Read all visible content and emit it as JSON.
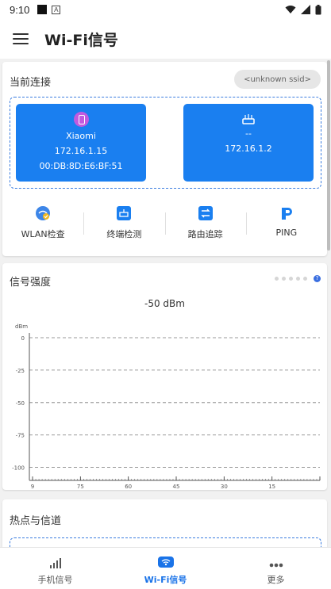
{
  "status_bar": {
    "time": "9:10",
    "app_badge": "A"
  },
  "app_bar": {
    "title": "Wi-Fi信号"
  },
  "connection": {
    "title": "当前连接",
    "ssid": "<unknown ssid>",
    "local_device": {
      "name": "Xiaomi",
      "ip": "172.16.1.15",
      "mac": "00:DB:8D:E6:BF:51"
    },
    "router": {
      "name": "--",
      "ip": "172.16.1.2"
    },
    "tools": [
      {
        "label": "WLAN检查",
        "icon": "wlan-check-icon"
      },
      {
        "label": "终端检测",
        "icon": "terminal-scan-icon"
      },
      {
        "label": "路由追踪",
        "icon": "route-trace-icon"
      },
      {
        "label": "PING",
        "icon": "ping-icon"
      }
    ]
  },
  "signal": {
    "title": "信号强度",
    "value": "-50  dBm",
    "help": "?"
  },
  "hotspot": {
    "title": "热点与信道"
  },
  "bottom_nav": [
    {
      "label": "手机信号",
      "icon": "signal-bars-icon",
      "active": false
    },
    {
      "label": "Wi-Fi信号",
      "icon": "wifi-badge-icon",
      "active": true
    },
    {
      "label": "更多",
      "icon": "more-icon",
      "active": false
    }
  ],
  "colors": {
    "accent": "#1a7ff0",
    "nav_active": "#1a73e8",
    "phone_icon": "#c25adf"
  },
  "chart_data": {
    "type": "line",
    "ylabel": "dBm",
    "yticks": [
      0,
      -25,
      -50,
      -75,
      -100
    ],
    "ytick_labels": [
      "0",
      "-25",
      "-50",
      "-75",
      "-100"
    ],
    "ylim": [
      -110,
      0
    ],
    "xticks": [
      90,
      75,
      60,
      45,
      30,
      15,
      0
    ],
    "xtick_labels": [
      "9",
      "75",
      "60",
      "45",
      "30",
      "15",
      ""
    ],
    "xlim": [
      91,
      0
    ],
    "series": [],
    "grid": true
  }
}
